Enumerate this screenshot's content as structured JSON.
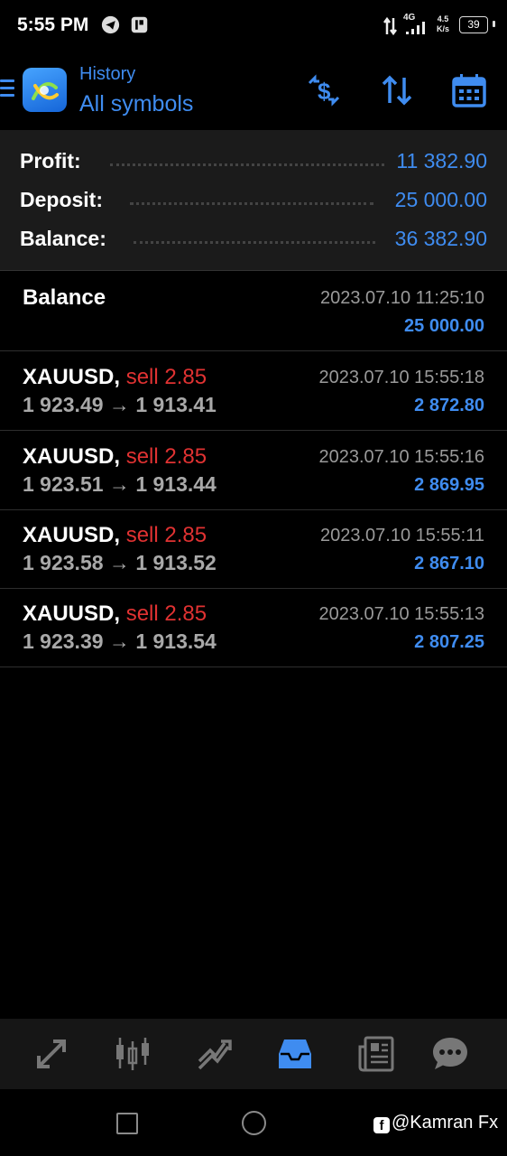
{
  "status_bar": {
    "time": "5:55 PM",
    "network": "4G",
    "speed_top": "4.5",
    "speed_bottom": "K/s",
    "battery": "39"
  },
  "header": {
    "subtitle": "History",
    "title": "All symbols"
  },
  "summary": {
    "profit_label": "Profit:",
    "profit_value": "11 382.90",
    "deposit_label": "Deposit:",
    "deposit_value": "25 000.00",
    "balance_label": "Balance:",
    "balance_value": "36 382.90"
  },
  "balance_entry": {
    "title": "Balance",
    "time": "2023.07.10 11:25:10",
    "amount": "25 000.00"
  },
  "deals": [
    {
      "symbol": "XAUUSD,",
      "type": "sell 2.85",
      "open": "1 923.49",
      "arrow": "→",
      "close": "1 913.41",
      "time": "2023.07.10 15:55:18",
      "profit": "2 872.80"
    },
    {
      "symbol": "XAUUSD,",
      "type": "sell 2.85",
      "open": "1 923.51",
      "arrow": "→",
      "close": "1 913.44",
      "time": "2023.07.10 15:55:16",
      "profit": "2 869.95"
    },
    {
      "symbol": "XAUUSD,",
      "type": "sell 2.85",
      "open": "1 923.58",
      "arrow": "→",
      "close": "1 913.52",
      "time": "2023.07.10 15:55:11",
      "profit": "2 867.10"
    },
    {
      "symbol": "XAUUSD,",
      "type": "sell 2.85",
      "open": "1 923.39",
      "arrow": "→",
      "close": "1 913.54",
      "time": "2023.07.10 15:55:13",
      "profit": "2 807.25"
    }
  ],
  "bottom_nav": {
    "items": [
      "quotes-icon",
      "chart-icon",
      "trade-icon",
      "history-icon",
      "news-icon",
      "chat-icon"
    ],
    "active": "history-icon"
  },
  "watermark": {
    "text": "@Kamran Fx"
  },
  "colors": {
    "accent": "#3f8cf0",
    "sell": "#e03232"
  }
}
